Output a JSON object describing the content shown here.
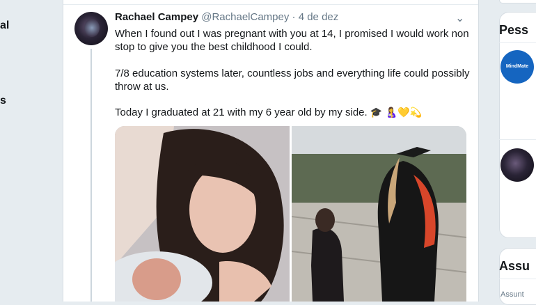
{
  "left_fragments": [
    "al",
    "s"
  ],
  "tweet": {
    "author_name": "Rachael Campey",
    "handle": "@RachaelCampey",
    "separator": " · ",
    "date": "4 de dez",
    "caret": "⌄",
    "paragraphs": [
      "When I found out I was pregnant with you at 14, I promised I would work non stop to give you the best childhood I could.",
      "7/8 education systems later, countless jobs and everything life could possibly throw at us.",
      "Today I graduated at 21 with my 6 year old by my side."
    ],
    "emojis": "🎓 🤱💛💫"
  },
  "right": {
    "who_to_follow_title": "Pess",
    "mindmate_avatar_text": "MindMate",
    "trends_title": "Assu",
    "trends_sub": "Assunt"
  }
}
